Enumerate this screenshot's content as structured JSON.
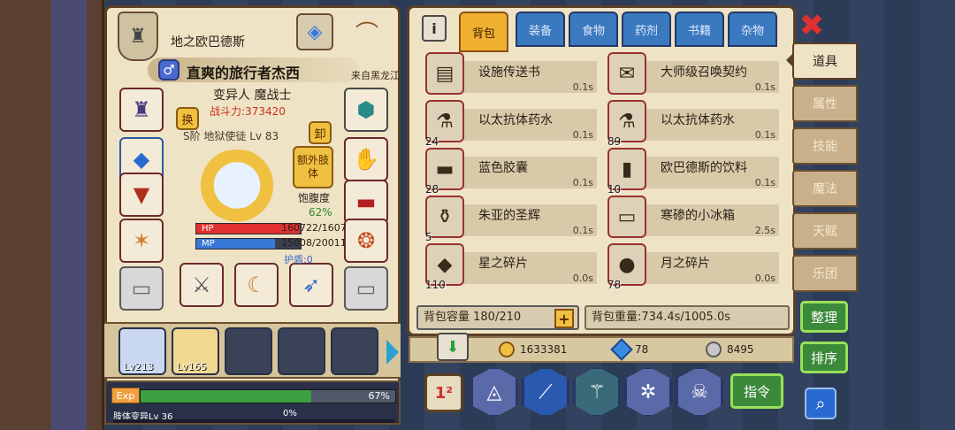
{
  "character": {
    "realm": "地之欧巴德斯",
    "name": "直爽的旅行者杰西",
    "origin": "来自黑龙江",
    "class": "变异人 魔战士",
    "power": "战斗力:373420",
    "title": "S阶 地狱使徒 Lv 83",
    "swap_label": "换",
    "unequip_label": "卸",
    "extra_limb_label": "额外肢体",
    "satiety_label": "饱腹度",
    "satiety_value": "62%",
    "hp_label": "HP",
    "hp_text": "160722/1607",
    "hp_fraction": 0.99,
    "mp_label": "MP",
    "mp_text": "15008/20011",
    "mp_fraction": 0.75,
    "shield_text": "护盾:0"
  },
  "party": [
    {
      "level": "Lv213",
      "filled": true
    },
    {
      "level": "Lv165",
      "filled": true
    },
    {
      "level": "",
      "filled": false
    },
    {
      "level": "",
      "filled": false
    },
    {
      "level": "",
      "filled": false
    }
  ],
  "exp": {
    "tag": "Exp",
    "percent": "67%",
    "fraction": 0.67,
    "limb_label": "肢体变异Lv 36",
    "limb_percent": "0%"
  },
  "inventory": {
    "tabs": [
      "背包",
      "装备",
      "食物",
      "药剂",
      "书籍",
      "杂物"
    ],
    "active_tab": 0,
    "items": [
      {
        "name": "设施传送书",
        "time": "0.1s",
        "count": "",
        "icon": "book-icon",
        "glyph": "▤"
      },
      {
        "name": "大师级召唤契约",
        "time": "0.1s",
        "count": "",
        "icon": "contract-icon",
        "glyph": "✉"
      },
      {
        "name": "以太抗体药水",
        "time": "0.1s",
        "count": "24",
        "icon": "potion-icon",
        "glyph": "⚗"
      },
      {
        "name": "以太抗体药水",
        "time": "0.1s",
        "count": "89",
        "icon": "potion-icon",
        "glyph": "⚗"
      },
      {
        "name": "蓝色胶囊",
        "time": "0.1s",
        "count": "28",
        "icon": "capsule-icon",
        "glyph": "▬"
      },
      {
        "name": "欧巴德斯的饮料",
        "time": "0.1s",
        "count": "10",
        "icon": "bottle-icon",
        "glyph": "▮"
      },
      {
        "name": "朱亚的圣辉",
        "time": "0.1s",
        "count": "5",
        "icon": "flask-icon",
        "glyph": "⚱"
      },
      {
        "name": "寒碜的小冰箱",
        "time": "2.5s",
        "count": "",
        "icon": "fridge-icon",
        "glyph": "▭"
      },
      {
        "name": "星之碎片",
        "time": "0.0s",
        "count": "110",
        "icon": "crystal-icon",
        "glyph": "◆"
      },
      {
        "name": "月之碎片",
        "time": "0.0s",
        "count": "78",
        "icon": "moon-orb-icon",
        "glyph": "●"
      }
    ],
    "capacity": "背包容量 180/210",
    "weight": "背包重量:734.4s/1005.0s"
  },
  "side_tabs": [
    "道具",
    "属性",
    "技能",
    "魔法",
    "天赋",
    "乐团"
  ],
  "buttons": {
    "sort": "整理",
    "order": "排序",
    "command": "指令",
    "plus": "+"
  },
  "currency": {
    "gold": "1633381",
    "gems": "78",
    "silver": "8495"
  },
  "colors": {
    "panel": "#efe3c6",
    "tab_active": "#f0b030",
    "tab_inactive": "#3a78c0",
    "hp": "#e03030",
    "mp": "#3a78d8",
    "exp": "#3aa040"
  }
}
